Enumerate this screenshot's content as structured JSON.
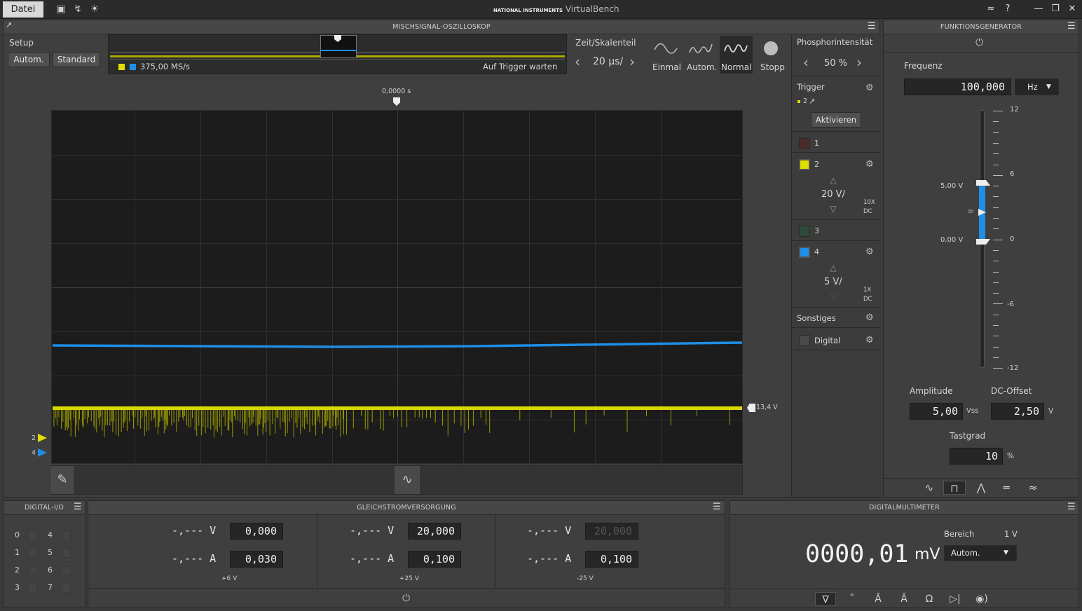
{
  "titlebar": {
    "file_tab": "Datei",
    "app_brand": "NATIONAL INSTRUMENTS",
    "app_name": "VirtualBench",
    "help": "?"
  },
  "scope": {
    "title": "MISCHSIGNAL-OSZILLOSKOP",
    "setup_label": "Setup",
    "auto_btn": "Autom.",
    "standard_btn": "Standard",
    "sample_rate": "375,00 MS/s",
    "trigger_status": "Auf Trigger warten",
    "time_label": "Zeit/Skalenteil",
    "time_value": "20 µs/",
    "modes": [
      {
        "label": "Einmal"
      },
      {
        "label": "Autom."
      },
      {
        "label": "Normal"
      },
      {
        "label": "Stopp"
      }
    ],
    "time_marker": "0,0000 s",
    "trigger_level": "13,4 V",
    "marker_ch2": "2",
    "marker_ch4": "4",
    "phosphor_label": "Phosphorintensität",
    "phosphor_value": "50 %",
    "trigger_label": "Trigger",
    "trigger_source": "2",
    "trigger_activate": "Aktivieren",
    "channels": [
      {
        "num": "1",
        "color": "#5a2a2a"
      },
      {
        "num": "2",
        "color": "#e0e000",
        "scale": "20 V/",
        "probe": "10X",
        "coupling": "DC"
      },
      {
        "num": "3",
        "color": "#2f4a3a"
      },
      {
        "num": "4",
        "color": "#1e8ee6",
        "scale": "5 V/",
        "probe": "1X",
        "coupling": "DC"
      }
    ],
    "misc_label": "Sonstiges",
    "digital_label": "Digital"
  },
  "fgen": {
    "title": "FUNKTIONSGENERATOR",
    "freq_label": "Frequenz",
    "freq_value": "100,000",
    "freq_unit": "Hz",
    "scale_labels": {
      "top": "12",
      "mid_hi": "6",
      "zero": "0",
      "mid_lo": "-6",
      "bottom": "-12"
    },
    "high_value": "5,00 V",
    "low_value": "0,00 V",
    "amp_label": "Amplitude",
    "amp_value": "5,00",
    "amp_unit": "Vss",
    "offset_label": "DC-Offset",
    "offset_value": "2,50",
    "offset_unit": "V",
    "duty_label": "Tastgrad",
    "duty_value": "10",
    "duty_unit": "%"
  },
  "dio": {
    "title": "DIGITAL-I/O",
    "pins_left": [
      "0",
      "1",
      "2",
      "3"
    ],
    "pins_right": [
      "4",
      "5",
      "6",
      "7"
    ]
  },
  "psu": {
    "title": "GLEICHSTROMVERSORGUNG",
    "channels": [
      {
        "v_meas": "-,--- V",
        "v_set": "0,000",
        "a_meas": "-,--- A",
        "a_set": "0,030",
        "name": "+6 V"
      },
      {
        "v_meas": "-,--- V",
        "v_set": "20,000",
        "a_meas": "-,--- A",
        "a_set": "0,100",
        "name": "+25 V"
      },
      {
        "v_meas": "-,--- V",
        "v_set": "20,000",
        "a_meas": "-,--- A",
        "a_set": "0,100",
        "name": "-25 V"
      }
    ]
  },
  "dmm": {
    "title": "DIGITALMULTIMETER",
    "range_label": "Bereich",
    "range_value": "1 V",
    "reading": "0000,01",
    "unit": "mV",
    "mode": "Autom."
  }
}
